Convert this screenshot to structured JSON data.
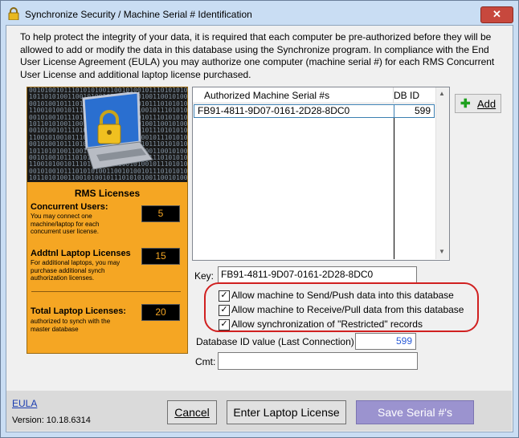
{
  "window": {
    "title": "Synchronize Security / Machine Serial # Identification",
    "close_label": "✕"
  },
  "intro": "To help protect the integrity of your data, it is required that each computer be pre-authorized before they will be allowed to add or modify the data in this database using the Synchronize program.   In compliance with the End User License Agreement (EULA) you may authorize one computer (machine serial #) for each RMS Concurrent User License and additional laptop license purchased.",
  "licenses": {
    "heading": "RMS Licenses",
    "concurrent": {
      "label": "Concurrent Users:",
      "desc": "You may connect one machine/laptop for each concurrent user license.",
      "value": "5"
    },
    "laptop": {
      "label": "Addtnl Laptop Licenses",
      "desc": "For additional laptops, you may purchase additional synch authorization licenses.",
      "value": "15"
    },
    "total": {
      "label": "Total Laptop Licenses:",
      "desc": "authorized to synch with the master database",
      "value": "20"
    }
  },
  "grid": {
    "columns": [
      "Authorized Machine Serial #s",
      "DB ID"
    ],
    "rows": [
      {
        "serial": "FB91-4811-9D07-0161-2D28-8DC0",
        "db_id": "599"
      }
    ]
  },
  "add_button": {
    "label": "Add"
  },
  "key": {
    "label": "Key:",
    "value": "FB91-4811-9D07-0161-2D28-8DC0"
  },
  "options": [
    {
      "label": "Allow machine to Send/Push data into this database",
      "checked": true
    },
    {
      "label": "Allow machine to Receive/Pull data from this database",
      "checked": true
    },
    {
      "label": "Allow synchronization of \"Restricted\" records",
      "checked": true
    }
  ],
  "db_id": {
    "label": "Database ID value (Last Connection)",
    "value": "599"
  },
  "comment": {
    "label": "Cmt:",
    "value": ""
  },
  "footer": {
    "eula": "EULA",
    "version": "Version: 10.18.6314",
    "cancel": "Cancel",
    "enter_license": "Enter Laptop License",
    "save": "Save Serial #'s"
  },
  "colors": {
    "accent": "#f5a623",
    "save_button": "#9b93cf",
    "highlight_ring": "#d02020",
    "link": "#1a3cb0"
  }
}
